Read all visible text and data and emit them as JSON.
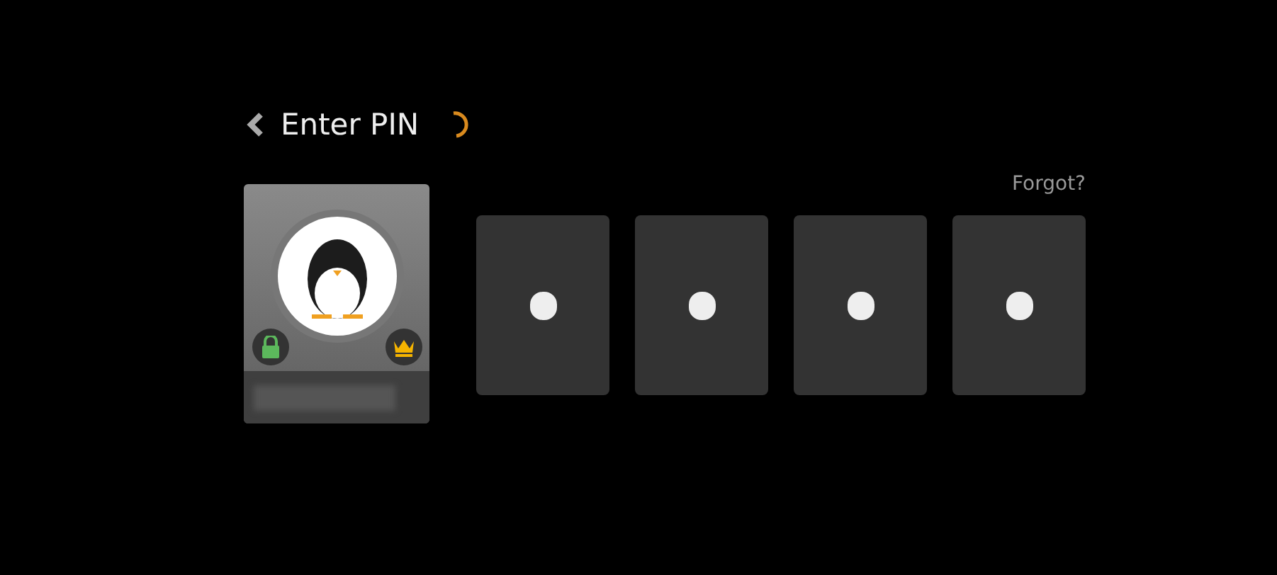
{
  "header": {
    "back": true,
    "title": "Enter PIN",
    "loading": true
  },
  "forgot_link": "Forgot?",
  "user": {
    "kind": "picture",
    "locked": true,
    "admin": true
  },
  "pin_boxes": [
    {
      "filled": true
    },
    {
      "filled": true
    },
    {
      "filled": true
    },
    {
      "filled": true
    }
  ]
}
